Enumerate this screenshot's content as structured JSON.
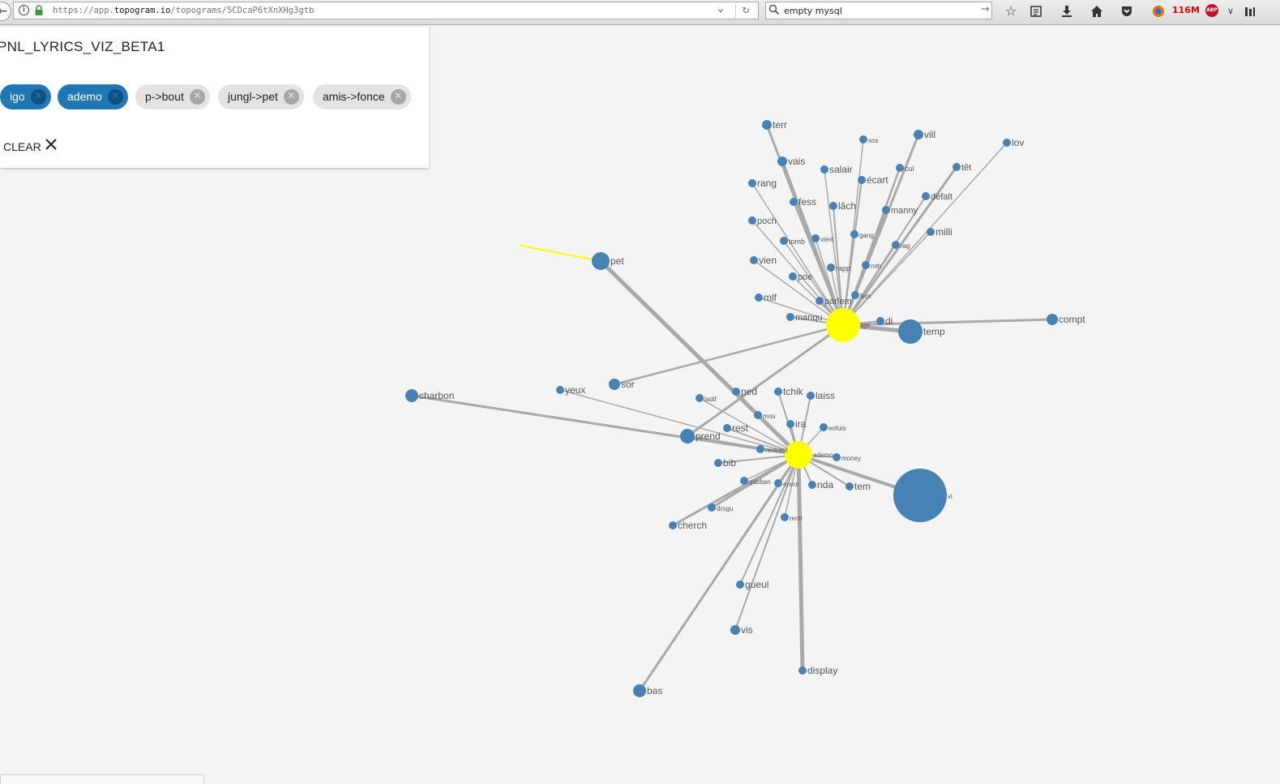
{
  "browser": {
    "url_prefix": "https://app.",
    "url_host": "topogram.io",
    "url_path": "/topograms/5CDcaP6tXnXHg3gtb",
    "search_value": "empty mysql",
    "memory": "116M",
    "adblock_badge": "ABP"
  },
  "panel": {
    "title": "PNL_LYRICS_VIZ_BETA1",
    "chips": [
      {
        "label": "igo",
        "active": true
      },
      {
        "label": "ademo",
        "active": true
      },
      {
        "label": "p->bout",
        "active": false
      },
      {
        "label": "jungl->pet",
        "active": false
      },
      {
        "label": "amis->fonce",
        "active": false
      }
    ],
    "clear_label": "CLEAR"
  },
  "colors": {
    "node": "#4682b4",
    "hub": "#ffff00",
    "edge": "#a9a9a9",
    "highlight_edge": "#ffff00",
    "chip_active": "#1f77b4",
    "chip_inactive": "#e3e3e3"
  },
  "graph": {
    "hubs": [
      {
        "id": "igo",
        "label": "igo"
      },
      {
        "id": "ademo",
        "label": "ademo"
      }
    ],
    "nodes": [
      {
        "id": "terr",
        "label": "terr"
      },
      {
        "id": "vill",
        "label": "vill"
      },
      {
        "id": "sos",
        "label": "sos"
      },
      {
        "id": "lov",
        "label": "lov"
      },
      {
        "id": "vais",
        "label": "vais"
      },
      {
        "id": "salair",
        "label": "salair"
      },
      {
        "id": "cul",
        "label": "cul"
      },
      {
        "id": "tet",
        "label": "têt"
      },
      {
        "id": "ecart",
        "label": "écart"
      },
      {
        "id": "rang",
        "label": "rang"
      },
      {
        "id": "defalt",
        "label": "défalt"
      },
      {
        "id": "fess",
        "label": "fess"
      },
      {
        "id": "lach",
        "label": "lâch"
      },
      {
        "id": "manny",
        "label": "manny"
      },
      {
        "id": "poch",
        "label": "poch"
      },
      {
        "id": "milli",
        "label": "milli"
      },
      {
        "id": "gang",
        "label": "gang"
      },
      {
        "id": "tomb",
        "label": "tomb"
      },
      {
        "id": "vient",
        "label": "vient"
      },
      {
        "id": "rag",
        "label": "rag"
      },
      {
        "id": "vien",
        "label": "vien"
      },
      {
        "id": "rapp",
        "label": "rapp"
      },
      {
        "id": "mth",
        "label": "mth"
      },
      {
        "id": "poe",
        "label": "poe"
      },
      {
        "id": "fem",
        "label": "fem"
      },
      {
        "id": "mlf",
        "label": "mlf"
      },
      {
        "id": "parlem",
        "label": "parlem"
      },
      {
        "id": "manqu",
        "label": "manqu"
      },
      {
        "id": "di",
        "label": "di"
      },
      {
        "id": "temp",
        "label": "temp"
      },
      {
        "id": "compt",
        "label": "compt"
      },
      {
        "id": "pet",
        "label": "pet"
      },
      {
        "id": "sor",
        "label": "sor"
      },
      {
        "id": "charbon",
        "label": "charbon"
      },
      {
        "id": "yeux",
        "label": "yeux"
      },
      {
        "id": "ped",
        "label": "ped"
      },
      {
        "id": "tchik",
        "label": "tchik"
      },
      {
        "id": "laiss",
        "label": "laiss"
      },
      {
        "id": "ladif",
        "label": "ladif"
      },
      {
        "id": "mou",
        "label": "mou"
      },
      {
        "id": "ira",
        "label": "ira"
      },
      {
        "id": "enfuis",
        "label": "enfuis"
      },
      {
        "id": "rest",
        "label": "rest"
      },
      {
        "id": "prend",
        "label": "prend"
      },
      {
        "id": "rentrent",
        "label": "rentrent"
      },
      {
        "id": "money",
        "label": "money"
      },
      {
        "id": "bib",
        "label": "bib"
      },
      {
        "id": "gabban",
        "label": "gabban"
      },
      {
        "id": "envoi",
        "label": "envoi"
      },
      {
        "id": "nda",
        "label": "nda"
      },
      {
        "id": "tem",
        "label": "tem"
      },
      {
        "id": "vi",
        "label": "vi"
      },
      {
        "id": "drogu",
        "label": "drogu"
      },
      {
        "id": "rentr",
        "label": "rentr"
      },
      {
        "id": "cherch",
        "label": "cherch"
      },
      {
        "id": "gueul",
        "label": "gueul"
      },
      {
        "id": "vis",
        "label": "vis"
      },
      {
        "id": "display",
        "label": "display"
      },
      {
        "id": "bas",
        "label": "bas"
      }
    ]
  }
}
